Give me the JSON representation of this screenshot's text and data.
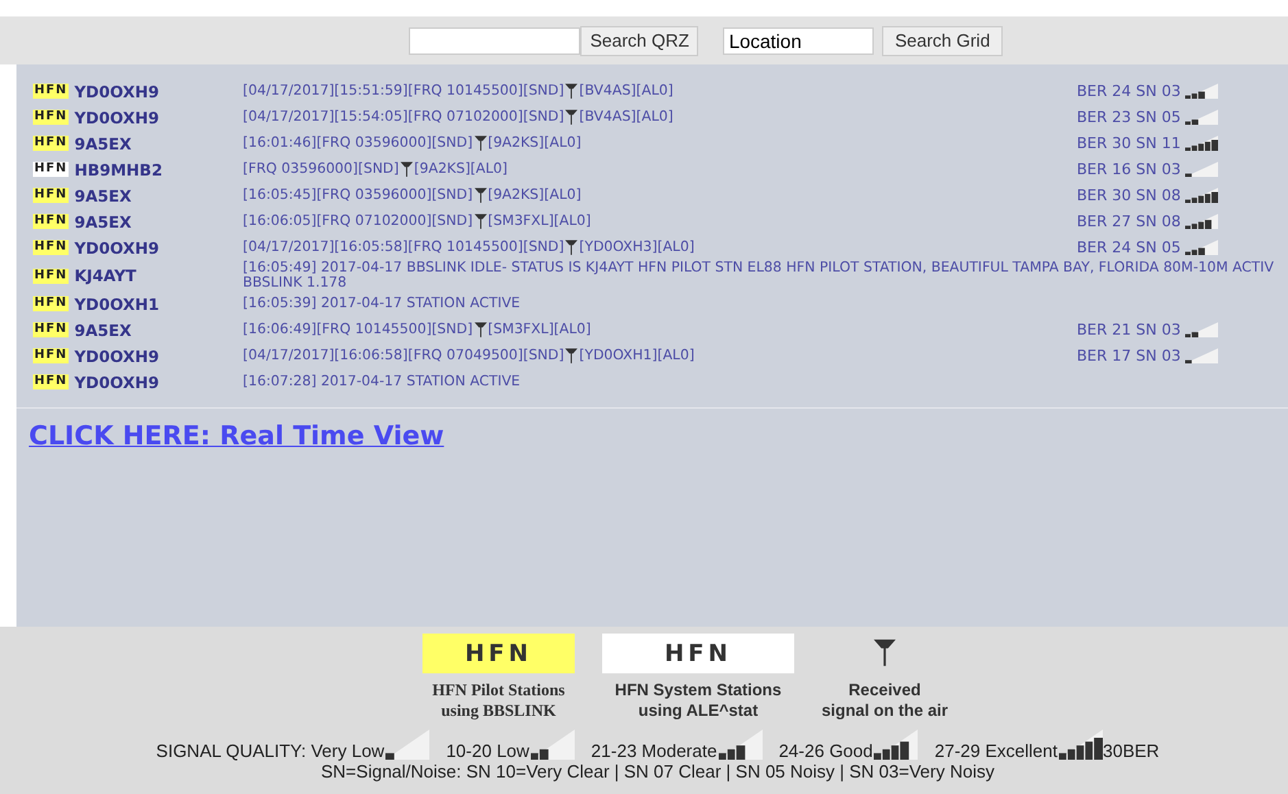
{
  "search": {
    "qrz_button": "Search QRZ",
    "location_field": {
      "value": "Location"
    },
    "grid_button": "Search Grid"
  },
  "rows": [
    {
      "badge": {
        "kind": "pilot",
        "text": "HFN"
      },
      "callsign": "YD0OXH9",
      "message": "[04/17/2017][15:51:59][FRQ 10145500][SND]",
      "received": true,
      "message_after": "[BV4AS][AL0]",
      "signal": {
        "text": "BER 24 SN 03",
        "level": 0.6
      }
    },
    {
      "badge": {
        "kind": "pilot",
        "text": "HFN"
      },
      "callsign": "YD0OXH9",
      "message": "[04/17/2017][15:54:05][FRQ 07102000][SND]",
      "received": true,
      "message_after": "[BV4AS][AL0]",
      "signal": {
        "text": "BER 23 SN 05",
        "level": 0.4
      }
    },
    {
      "badge": {
        "kind": "pilot",
        "text": "HFN"
      },
      "callsign": "9A5EX",
      "message": "[16:01:46][FRQ 03596000][SND]",
      "received": true,
      "message_after": "[9A2KS][AL0]",
      "signal": {
        "text": "BER 30 SN 11",
        "level": 1
      }
    },
    {
      "badge": {
        "kind": "system",
        "text": "HFN"
      },
      "callsign": "HB9MHB2",
      "message": "[FRQ 03596000][SND]",
      "received": true,
      "message_after": "[9A2KS][AL0]",
      "signal": {
        "text": "BER 16 SN 03",
        "level": 0.2
      }
    },
    {
      "badge": {
        "kind": "pilot",
        "text": "HFN"
      },
      "callsign": "9A5EX",
      "message": "[16:05:45][FRQ 03596000][SND]",
      "received": true,
      "message_after": "[9A2KS][AL0]",
      "signal": {
        "text": "BER 30 SN 08",
        "level": 1
      }
    },
    {
      "badge": {
        "kind": "pilot",
        "text": "HFN"
      },
      "callsign": "9A5EX",
      "message": "[16:06:05][FRQ 07102000][SND]",
      "received": true,
      "message_after": "[SM3FXL][AL0]",
      "signal": {
        "text": "BER 27 SN 08",
        "level": 0.8
      }
    },
    {
      "badge": {
        "kind": "pilot",
        "text": "HFN"
      },
      "callsign": "YD0OXH9",
      "message": "[04/17/2017][16:05:58][FRQ 10145500][SND]",
      "received": true,
      "message_after": "[YD0OXH3][AL0]",
      "signal": {
        "text": "BER 24 SN 05",
        "level": 0.6
      }
    },
    {
      "badge": {
        "kind": "pilot",
        "text": "HFN"
      },
      "callsign": "KJ4AYT",
      "message": "[16:05:49] 2017-04-17 BBSLINK IDLE- STATUS IS KJ4AYT HFN PILOT STN EL88 HFN PILOT STATION, BEAUTIFUL TAMPA BAY, FLORIDA 80M-10M ACTIV",
      "received": false,
      "message_line2": "BBSLINK 1.178"
    },
    {
      "badge": {
        "kind": "pilot",
        "text": "HFN"
      },
      "callsign": "YD0OXH1",
      "message": "[16:05:39] 2017-04-17 STATION ACTIVE",
      "received": false
    },
    {
      "badge": {
        "kind": "pilot",
        "text": "HFN"
      },
      "callsign": "9A5EX",
      "message": "[16:06:49][FRQ 10145500][SND]",
      "received": true,
      "message_after": "[SM3FXL][AL0]",
      "signal": {
        "text": "BER 21 SN 03",
        "level": 0.4
      }
    },
    {
      "badge": {
        "kind": "pilot",
        "text": "HFN"
      },
      "callsign": "YD0OXH9",
      "message": "[04/17/2017][16:06:58][FRQ 07049500][SND]",
      "received": true,
      "message_after": "[YD0OXH1][AL0]",
      "signal": {
        "text": "BER 17 SN 03",
        "level": 0.2
      }
    },
    {
      "badge": {
        "kind": "pilot",
        "text": "HFN"
      },
      "callsign": "YD0OXH9",
      "message": "[16:07:28] 2017-04-17 STATION ACTIVE",
      "received": false
    }
  ],
  "link": "CLICK HERE: Real Time View",
  "legend": [
    {
      "kind": "pilot",
      "badge": "HFN",
      "caption": [
        "HFN Pilot Stations",
        "using BBSLINK"
      ]
    },
    {
      "kind": "system",
      "badge": "HFN",
      "caption": [
        "HFN System Stations",
        "using ALE^stat"
      ]
    },
    {
      "kind": "received",
      "caption": [
        "Received",
        "signal on the air"
      ]
    }
  ],
  "signal_quality": {
    "items": [
      {
        "label": "SIGNAL QUALITY: Very Low",
        "level": 0.2
      },
      {
        "label": "10-20 Low",
        "level": 0.4
      },
      {
        "label": "21-23 Moderate",
        "level": 0.6
      },
      {
        "label": "24-26 Good",
        "level": 0.8
      },
      {
        "label": "27-29 Excellent",
        "level": 1
      }
    ],
    "suffix": "30BER"
  },
  "sn_note": "SN=Signal/Noise: SN 10=Very Clear | SN 07 Clear | SN 05 Noisy | SN 03=Very Noisy"
}
